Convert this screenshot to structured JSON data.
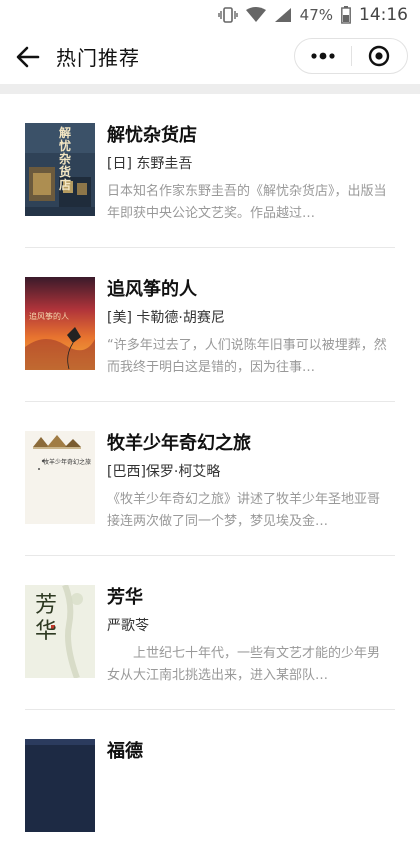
{
  "status": {
    "battery_percent": "47%",
    "time": "14:16"
  },
  "nav": {
    "title": "热门推荐"
  },
  "books": [
    {
      "title": "解忧杂货店",
      "author": "[日] 东野圭吾",
      "desc": "日本知名作家东野圭吾的《解忧杂货店》，出版当年即获中央公论文艺奖。作品越过…",
      "cover_text": "解忧杂货店"
    },
    {
      "title": "追风筝的人",
      "author": "[美] 卡勒德·胡赛尼",
      "desc": "“许多年过去了，人们说陈年旧事可以被埋葬，然而我终于明白这是错的，因为往事…",
      "cover_text": "追风筝的人"
    },
    {
      "title": "牧羊少年奇幻之旅",
      "author": "[巴西]保罗·柯艾略",
      "desc": "《牧羊少年奇幻之旅》讲述了牧羊少年圣地亚哥接连两次做了同一个梦，梦见埃及金…",
      "cover_text": "牧羊少年奇幻之旅"
    },
    {
      "title": "芳华",
      "author": "严歌苓",
      "desc": "　　上世纪七十年代，一些有文艺才能的少年男女从大江南北挑选出来，进入某部队…",
      "cover_text": "芳华"
    },
    {
      "title": "福德",
      "author": "",
      "desc": "",
      "cover_text": ""
    }
  ]
}
